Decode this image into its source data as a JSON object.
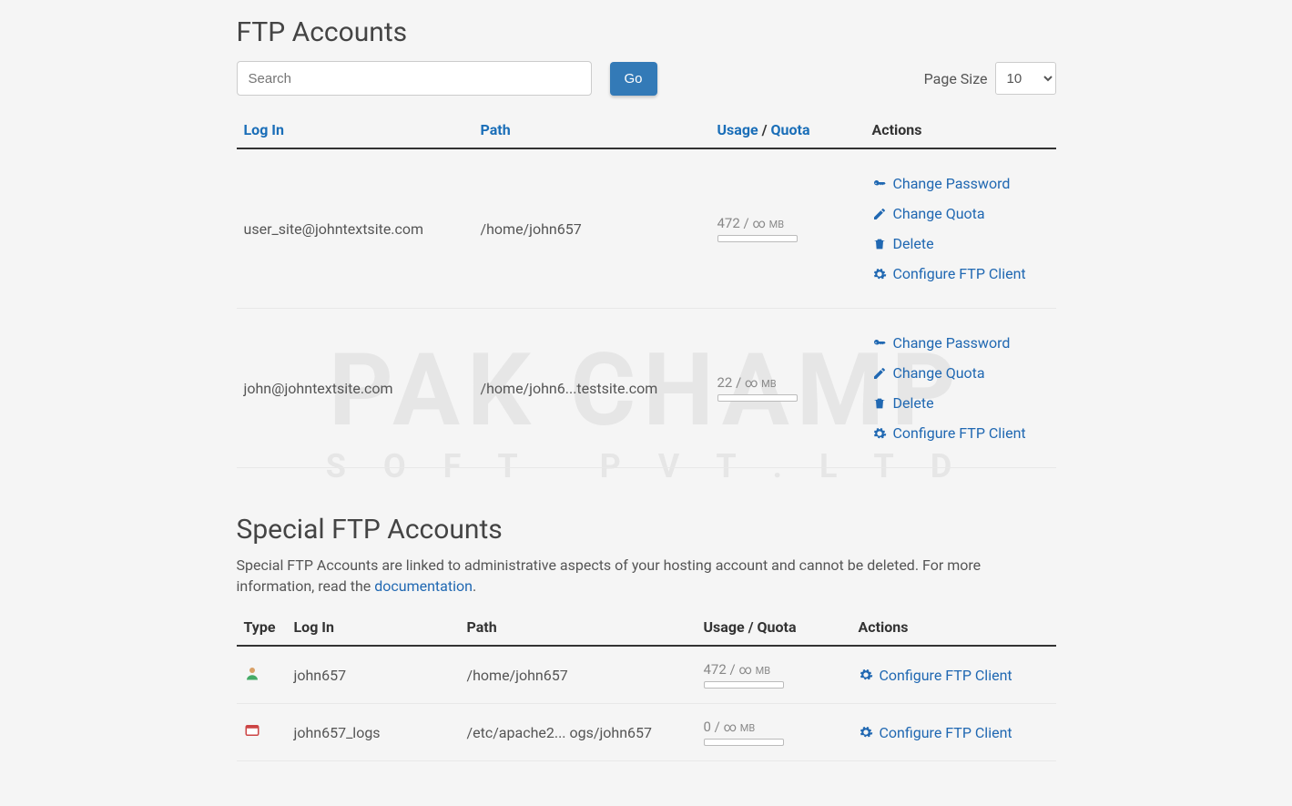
{
  "ftp": {
    "title": "FTP Accounts",
    "searchPlaceholder": "Search",
    "goLabel": "Go",
    "pageSizeLabel": "Page Size",
    "pageSizeValue": "10",
    "headers": {
      "login": "Log In",
      "path": "Path",
      "usage": "Usage",
      "quota": "Quota",
      "actions": "Actions"
    },
    "actions": {
      "changePassword": "Change Password",
      "changeQuota": "Change Quota",
      "delete": "Delete",
      "configure": "Configure FTP Client"
    },
    "rows": [
      {
        "login": "user_site@johntextsite.com",
        "path": "/home/john657",
        "usage": "472",
        "quota": "∞",
        "unit": "MB"
      },
      {
        "login": "john@johntextsite.com",
        "path": "/home/john6...testsite.com",
        "usage": "22",
        "quota": "∞",
        "unit": "MB"
      }
    ]
  },
  "special": {
    "title": "Special FTP Accounts",
    "descPrefix": "Special FTP Accounts are linked to administrative aspects of your hosting account and cannot be deleted. For more information, read the ",
    "docLink": "documentation",
    "descSuffix": ".",
    "headers": {
      "type": "Type",
      "login": "Log In",
      "path": "Path",
      "usageQuota": "Usage / Quota",
      "actions": "Actions"
    },
    "actions": {
      "configure": "Configure FTP Client"
    },
    "rows": [
      {
        "typeIcon": "user-icon",
        "login": "john657",
        "path": "/home/john657",
        "usage": "472",
        "quota": "∞",
        "unit": "MB"
      },
      {
        "typeIcon": "logs-icon",
        "login": "john657_logs",
        "path": "/etc/apache2... ogs/john657",
        "usage": "0",
        "quota": "∞",
        "unit": "MB"
      }
    ]
  }
}
